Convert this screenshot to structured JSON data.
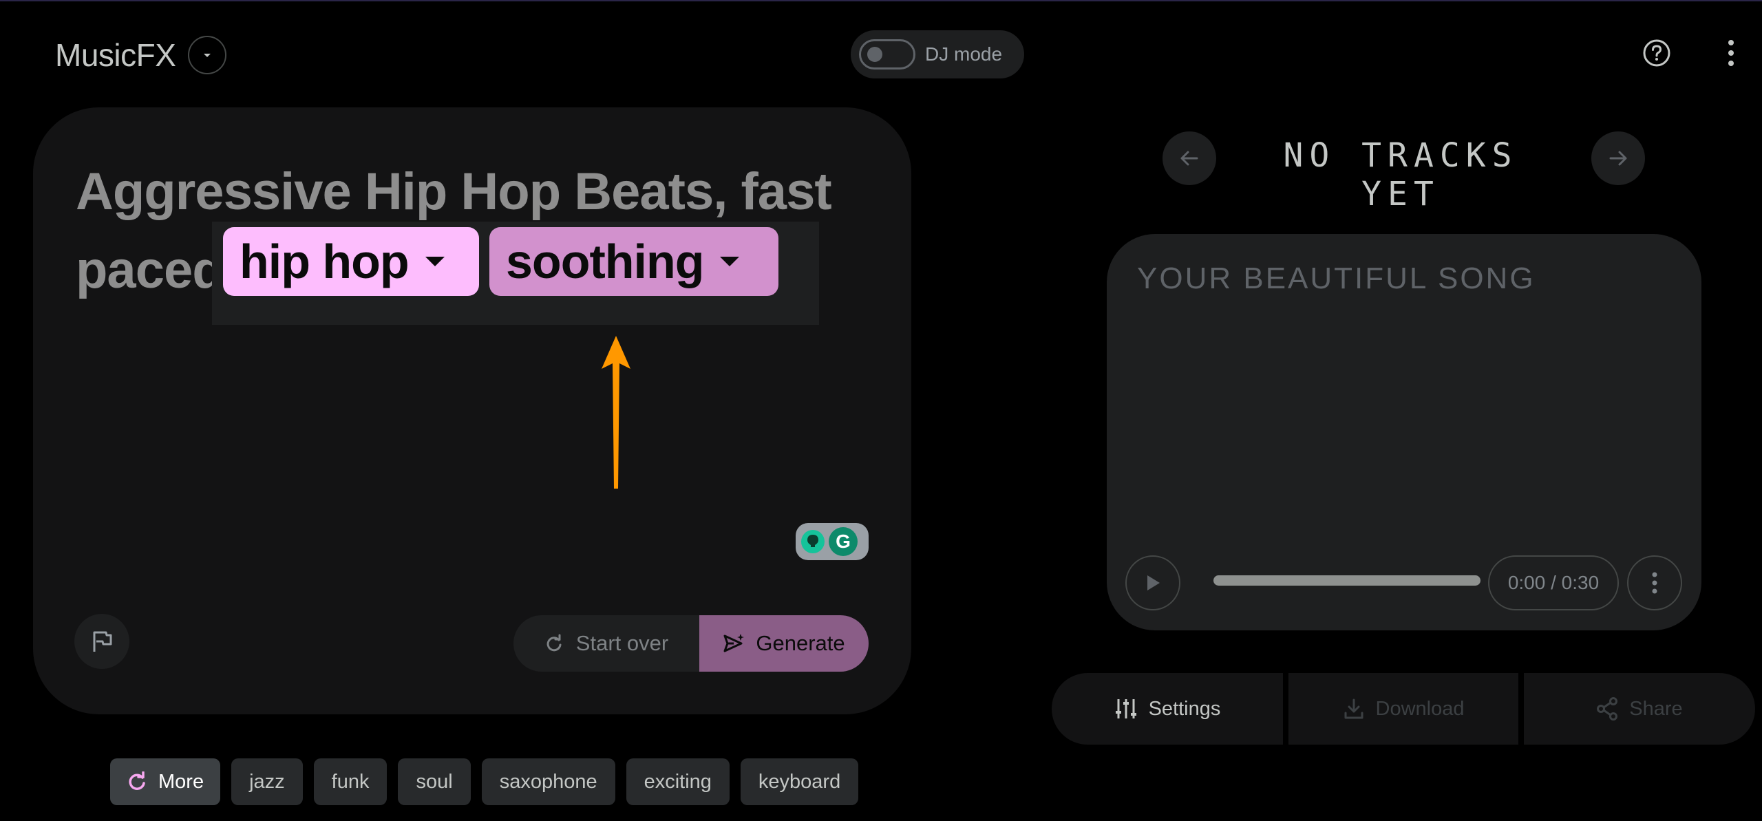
{
  "header": {
    "app_title": "MusicFX",
    "dj_mode_label": "DJ mode"
  },
  "prompt": {
    "text": "Aggressive Hip Hop Beats, fast paced",
    "chips": [
      {
        "label": "hip hop",
        "color": "#fdbdfd"
      },
      {
        "label": "soothing",
        "color": "#d291cd"
      }
    ],
    "start_over_label": "Start over",
    "generate_label": "Generate"
  },
  "suggestions": {
    "more_label": "More",
    "items": [
      "jazz",
      "funk",
      "soul",
      "saxophone",
      "exciting",
      "keyboard"
    ]
  },
  "player": {
    "tracks_title": "NO TRACKS YET",
    "song_title": "YOUR BEAUTIFUL SONG",
    "time": "0:00 / 0:30"
  },
  "actions": {
    "settings_label": "Settings",
    "download_label": "Download",
    "share_label": "Share"
  },
  "colors": {
    "background": "#000000",
    "accent": "#fdbdfd",
    "generate": "#8a5d87",
    "annotation_arrow": "#ff9800"
  }
}
